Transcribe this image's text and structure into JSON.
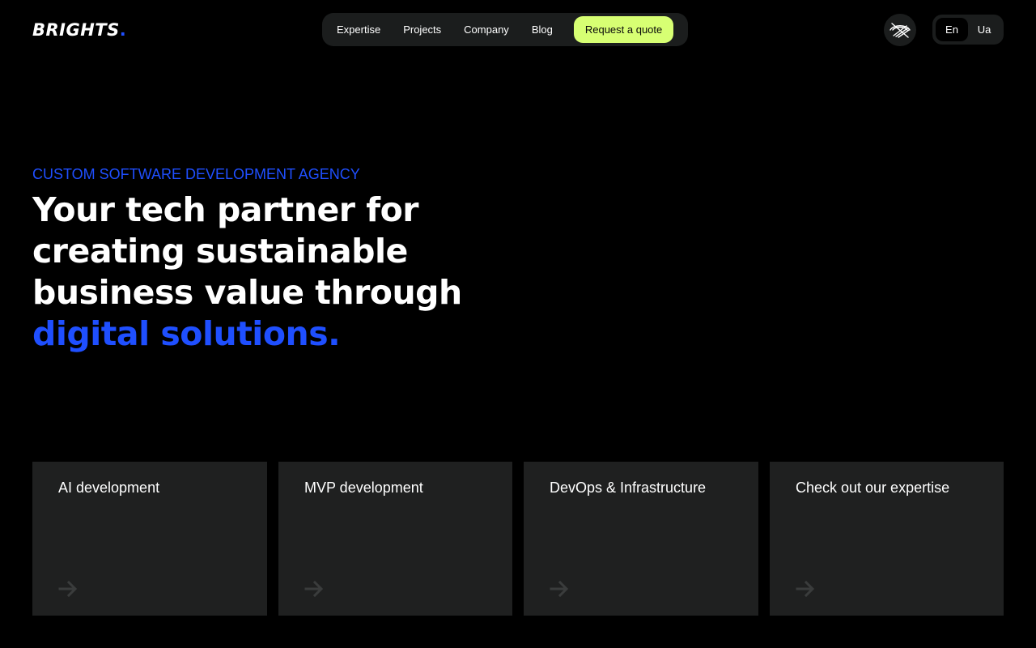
{
  "brand": {
    "name": "BRIGHTS",
    "dot": ".",
    "accent_color": "#1f4fff"
  },
  "nav": {
    "items": [
      {
        "label": "Expertise"
      },
      {
        "label": "Projects"
      },
      {
        "label": "Company"
      },
      {
        "label": "Blog"
      }
    ],
    "cta_label": "Request a quote",
    "cta_color": "#d7ff73"
  },
  "accessibility": {
    "icon": "eye-off-icon"
  },
  "language": {
    "options": [
      {
        "label": "En",
        "active": true
      },
      {
        "label": "Ua",
        "active": false
      }
    ]
  },
  "hero": {
    "eyebrow": "CUSTOM SOFTWARE DEVELOPMENT AGENCY",
    "title_main": "Your tech partner for creating sustainable business value through ",
    "title_accent": "digital solutions."
  },
  "cards": [
    {
      "title": "AI development",
      "icon": "arrow-right-icon"
    },
    {
      "title": "MVP development",
      "icon": "arrow-right-icon"
    },
    {
      "title": "DevOps & Infrastructure",
      "icon": "arrow-right-icon"
    },
    {
      "title": "Check out our expertise",
      "icon": "arrow-right-icon"
    }
  ]
}
